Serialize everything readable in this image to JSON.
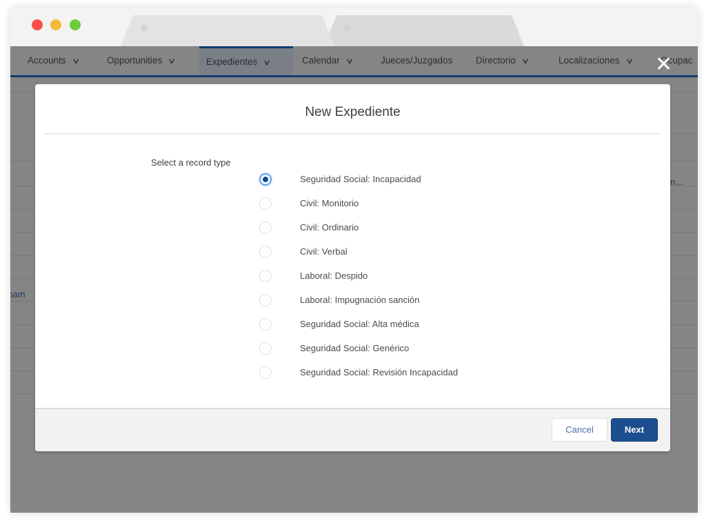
{
  "browser": {
    "tabs": [
      {
        "label": ""
      },
      {
        "label": ""
      }
    ]
  },
  "navbar": {
    "items": [
      {
        "label": "Accounts",
        "has_menu": true,
        "active": false
      },
      {
        "label": "Opportunities",
        "has_menu": true,
        "active": false
      },
      {
        "label": "Expedientes",
        "has_menu": true,
        "active": true
      },
      {
        "label": "Calendar",
        "has_menu": true,
        "active": false
      },
      {
        "label": "Jueces/Juzgados",
        "has_menu": false,
        "active": false
      },
      {
        "label": "Directorio",
        "has_menu": true,
        "active": false
      },
      {
        "label": "Localizaciones",
        "has_menu": true,
        "active": false
      },
      {
        "label": "Ocupac",
        "has_menu": false,
        "active": false
      }
    ],
    "chevron_glyph": "∨"
  },
  "background": {
    "partial_left_text": "rnam",
    "partial_right_text": "n..."
  },
  "close_icon_glyph": "✕",
  "modal": {
    "title": "New Expediente",
    "field_label": "Select a record type",
    "selected_index": 0,
    "options": [
      {
        "label": "Seguridad Social: Incapacidad"
      },
      {
        "label": "Civil: Monitorio"
      },
      {
        "label": "Civil: Ordinario"
      },
      {
        "label": "Civil: Verbal"
      },
      {
        "label": "Laboral: Despido"
      },
      {
        "label": "Laboral: Impugnación sanción"
      },
      {
        "label": "Seguridad Social: Alta médica"
      },
      {
        "label": "Seguridad Social: Genérico"
      },
      {
        "label": "Seguridad Social: Revisión Incapacidad"
      }
    ],
    "footer": {
      "cancel_label": "Cancel",
      "next_label": "Next"
    }
  },
  "colors": {
    "brand_blue": "#1c4e8f",
    "nav_accent": "#0e3b73",
    "overlay_gray": "#858585"
  }
}
